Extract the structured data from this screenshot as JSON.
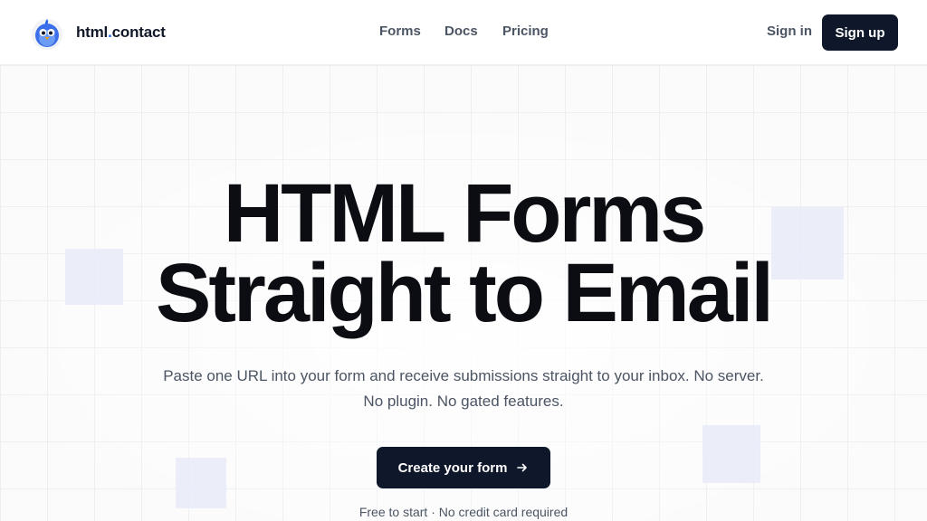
{
  "header": {
    "brand": {
      "name_part1": "html",
      "name_part2": "contact",
      "separator": "."
    },
    "nav": [
      {
        "label": "Forms"
      },
      {
        "label": "Docs"
      },
      {
        "label": "Pricing"
      }
    ],
    "sign_in_label": "Sign in",
    "sign_up_label": "Sign up"
  },
  "hero": {
    "headline_line1": "HTML Forms",
    "headline_line2": "Straight to Email",
    "subtitle": "Paste one URL into your form and receive submissions straight to your inbox. No server. No plugin. No gated features.",
    "cta_label": "Create your form",
    "note": "Free to start · No credit card required"
  },
  "icons": {
    "logo": "bird-logo-icon",
    "cta": "arrow-right-icon"
  },
  "colors": {
    "primary_dark": "#0f172a",
    "brand_accent": "#2563eb",
    "muted_text": "#4b5563",
    "tint_square": "#e7ebf8"
  }
}
